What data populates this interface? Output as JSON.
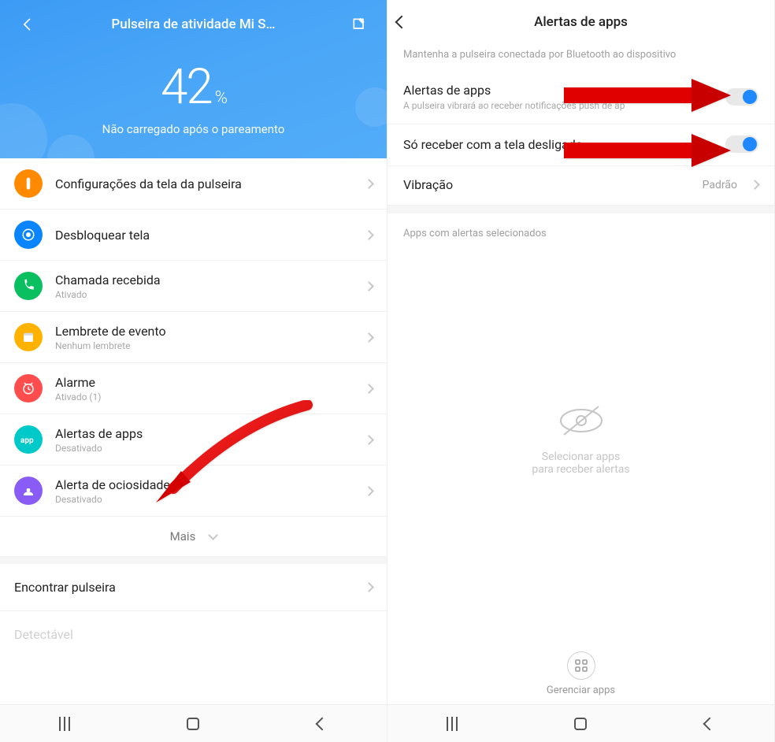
{
  "left": {
    "header": {
      "title": "Pulseira de atividade Mi S…",
      "battery_value": "42",
      "battery_pct_symbol": "%",
      "battery_subtitle": "Não carregado após o pareamento"
    },
    "items": [
      {
        "icon": "band-icon",
        "color": "ic-orange",
        "label": "Configurações da tela da pulseira",
        "sub": ""
      },
      {
        "icon": "unlock-icon",
        "color": "ic-blue",
        "label": "Desbloquear tela",
        "sub": ""
      },
      {
        "icon": "phone-icon",
        "color": "ic-green",
        "label": "Chamada recebida",
        "sub": "Ativado"
      },
      {
        "icon": "calendar-icon",
        "color": "ic-yellow",
        "label": "Lembrete de evento",
        "sub": "Nenhum lembrete"
      },
      {
        "icon": "alarm-icon",
        "color": "ic-red",
        "label": "Alarme",
        "sub": "Ativado (1)"
      },
      {
        "icon": "app-icon",
        "color": "ic-teal",
        "label": "Alertas de apps",
        "sub": "Desativado"
      },
      {
        "icon": "idle-icon",
        "color": "ic-violet",
        "label": "Alerta de ociosidade",
        "sub": "Desativado"
      }
    ],
    "more_label": "Mais",
    "plain_rows": {
      "find_band": "Encontrar pulseira",
      "detectable": "Detectável"
    }
  },
  "right": {
    "title": "Alertas de apps",
    "top_hint": "Mantenha a pulseira conectada por Bluetooth ao dispositivo",
    "settings": {
      "app_alerts_label": "Alertas de apps",
      "app_alerts_desc": "A pulseira vibrará ao receber notificações push de ap",
      "screen_off_label": "Só receber com a tela desligada",
      "vibration_label": "Vibração",
      "vibration_value": "Padrão"
    },
    "section_hint": "Apps com alertas selecionados",
    "empty": {
      "line1": "Selecionar apps",
      "line2": "para receber alertas"
    },
    "manage_label": "Gerenciar apps"
  },
  "nav": {
    "back": "back",
    "home": "home",
    "recent": "recent"
  }
}
